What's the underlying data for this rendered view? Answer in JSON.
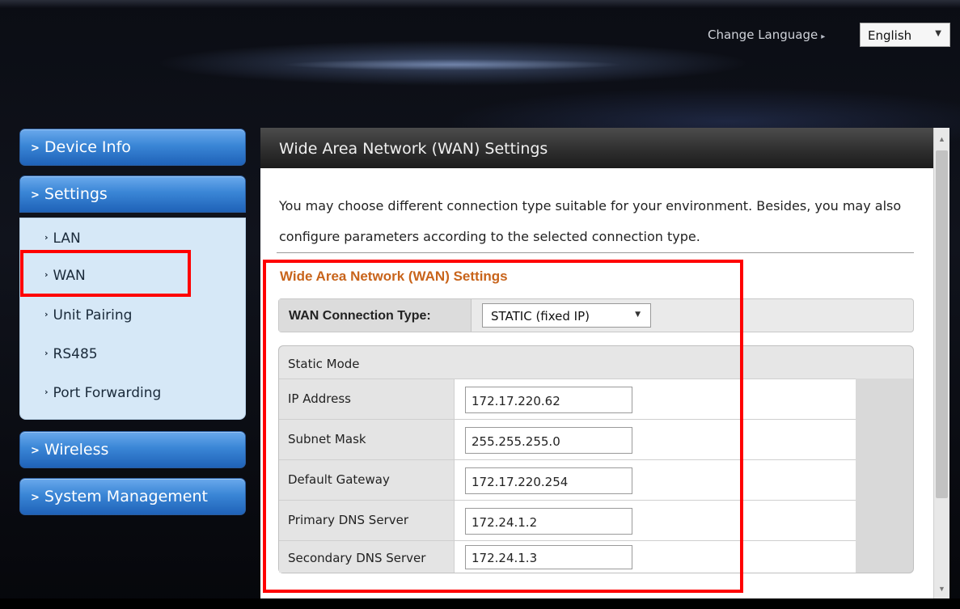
{
  "header": {
    "change_language_label": "Change Language",
    "language_selected": "English"
  },
  "sidebar": {
    "device_info": "Device Info",
    "settings": "Settings",
    "settings_items": [
      "LAN",
      "WAN",
      "Unit Pairing",
      "RS485",
      "Port Forwarding"
    ],
    "wireless": "Wireless",
    "system_management": "System Management",
    "highlighted_item": "WAN"
  },
  "main": {
    "panel_title": "Wide Area Network (WAN) Settings",
    "intro_text": "You may choose different connection type suitable for your environment. Besides, you may also configure parameters according to the selected connection type.",
    "section_title": "Wide Area Network (WAN) Settings",
    "connection_type_label": "WAN Connection Type:",
    "connection_type_value": "STATIC (fixed IP)",
    "static_mode_title": "Static Mode",
    "fields": [
      {
        "label": "IP Address",
        "value": "172.17.220.62"
      },
      {
        "label": "Subnet Mask",
        "value": "255.255.255.0"
      },
      {
        "label": "Default Gateway",
        "value": "172.17.220.254"
      },
      {
        "label": "Primary DNS Server",
        "value": "172.24.1.2"
      },
      {
        "label": "Secondary DNS Server",
        "value": "172.24.1.3"
      }
    ]
  },
  "colors": {
    "highlight": "#ff0000",
    "section_title": "#c8641b",
    "nav_blue": "#3a86d6"
  },
  "icons": {
    "chevron": "chevron-right-icon",
    "dropdown": "chevron-down-icon"
  }
}
